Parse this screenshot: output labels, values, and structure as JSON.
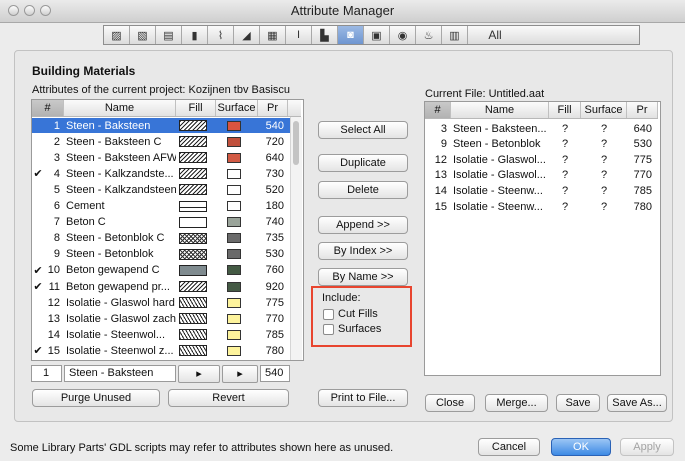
{
  "window": {
    "title": "Attribute Manager"
  },
  "toolbar": {
    "icons": [
      "fill-icon",
      "line-type-icon",
      "composite-icon",
      "pen-icon",
      "zone-icon",
      "material-icon",
      "profile-icon",
      "layer-icon",
      "building-material-icon",
      "model-view-icon",
      "markup-icon",
      "location-icon",
      "project-phase-icon",
      "renovation-icon"
    ],
    "glyphs": [
      "▨",
      "▧",
      "▤",
      "▮",
      "⌇",
      "◢",
      "▦",
      "I",
      "▙",
      "◙",
      "▣",
      "◉",
      "♨",
      "▥"
    ],
    "selected_index": 9,
    "all_label": "All"
  },
  "group_title": "Building Materials",
  "left": {
    "title": "Attributes of the current project: Kozijnen tbv Basiscur",
    "headers": {
      "num": "#",
      "name": "Name",
      "fill": "Fill",
      "surface": "Surface",
      "pr": "Pr"
    },
    "rows": [
      {
        "check": "",
        "num": "1",
        "name": "Steen - Baksteen",
        "fill": "hatch",
        "surface": "#d9543f",
        "pr": "540",
        "selected": true
      },
      {
        "check": "",
        "num": "2",
        "name": "Steen - Baksteen C",
        "fill": "hatch",
        "surface": "#c0503c",
        "pr": "720"
      },
      {
        "check": "",
        "num": "3",
        "name": "Steen - Baksteen AFW",
        "fill": "hatch",
        "surface": "#d25a44",
        "pr": "640"
      },
      {
        "check": "✔",
        "num": "4",
        "name": "Steen - Kalkzandste...",
        "fill": "hatch",
        "surface": "#ffffff",
        "pr": "730"
      },
      {
        "check": "",
        "num": "5",
        "name": "Steen - Kalkzandsteen",
        "fill": "hatch",
        "surface": "#ffffff",
        "pr": "520"
      },
      {
        "check": "",
        "num": "6",
        "name": "Cement",
        "fill": "wave",
        "surface": "#ffffff",
        "pr": "180"
      },
      {
        "check": "",
        "num": "7",
        "name": "Beton C",
        "fill": "blank",
        "surface": "#9aa49a",
        "pr": "740"
      },
      {
        "check": "",
        "num": "8",
        "name": "Steen - Betonblok C",
        "fill": "cross",
        "surface": "#6a6a6a",
        "pr": "735"
      },
      {
        "check": "",
        "num": "9",
        "name": "Steen - Betonblok",
        "fill": "cross",
        "surface": "#6a6a6a",
        "pr": "530"
      },
      {
        "check": "✔",
        "num": "10",
        "name": "Beton gewapend C",
        "fill": "solid",
        "surface": "#445a44",
        "pr": "760"
      },
      {
        "check": "✔",
        "num": "11",
        "name": "Beton gewapend pr...",
        "fill": "hatch",
        "surface": "#445a44",
        "pr": "920"
      },
      {
        "check": "",
        "num": "12",
        "name": "Isolatie - Glaswol hard",
        "fill": "zigzag",
        "surface": "#fdf39c",
        "pr": "775"
      },
      {
        "check": "",
        "num": "13",
        "name": "Isolatie - Glaswol zacht",
        "fill": "zigzag",
        "surface": "#fdf39c",
        "pr": "770"
      },
      {
        "check": "",
        "num": "14",
        "name": "Isolatie - Steenwol...",
        "fill": "zigzag",
        "surface": "#fdf39c",
        "pr": "785"
      },
      {
        "check": "✔",
        "num": "15",
        "name": "Isolatie - Steenwol z...",
        "fill": "zigzag",
        "surface": "#fdf39c",
        "pr": "780"
      }
    ],
    "edit": {
      "num": "1",
      "name": "Steen - Baksteen",
      "fill_arrow": "▸",
      "surface_arrow": "▸",
      "pr": "540"
    }
  },
  "middle": {
    "select_all": "Select All",
    "duplicate": "Duplicate",
    "delete": "Delete",
    "append": "Append >>",
    "by_index": "By Index >>",
    "by_name": "By Name >>",
    "include_label": "Include:",
    "cut_fills": "Cut Fills",
    "surfaces": "Surfaces"
  },
  "right": {
    "title": "Current File: Untitled.aat",
    "headers": {
      "num": "#",
      "name": "Name",
      "fill": "Fill",
      "surface": "Surface",
      "pr": "Pr"
    },
    "rows": [
      {
        "num": "3",
        "name": "Steen - Baksteen...",
        "fill": "?",
        "surface": "?",
        "pr": "640"
      },
      {
        "num": "9",
        "name": "Steen - Betonblok",
        "fill": "?",
        "surface": "?",
        "pr": "530"
      },
      {
        "num": "12",
        "name": "Isolatie - Glaswol...",
        "fill": "?",
        "surface": "?",
        "pr": "775"
      },
      {
        "num": "13",
        "name": "Isolatie - Glaswol...",
        "fill": "?",
        "surface": "?",
        "pr": "770"
      },
      {
        "num": "14",
        "name": "Isolatie - Steenw...",
        "fill": "?",
        "surface": "?",
        "pr": "785"
      },
      {
        "num": "15",
        "name": "Isolatie - Steenw...",
        "fill": "?",
        "surface": "?",
        "pr": "780"
      }
    ]
  },
  "bottom": {
    "purge": "Purge Unused",
    "revert": "Revert",
    "print": "Print to File...",
    "close": "Close",
    "merge": "Merge...",
    "save": "Save",
    "save_as": "Save As..."
  },
  "footer": {
    "note": "Some Library Parts' GDL scripts may refer to attributes shown here as unused.",
    "cancel": "Cancel",
    "ok": "OK",
    "apply": "Apply"
  },
  "colors": {
    "selection": "#3875d7",
    "highlight_box": "#e8452f",
    "default_button": "#3d8ae5"
  }
}
